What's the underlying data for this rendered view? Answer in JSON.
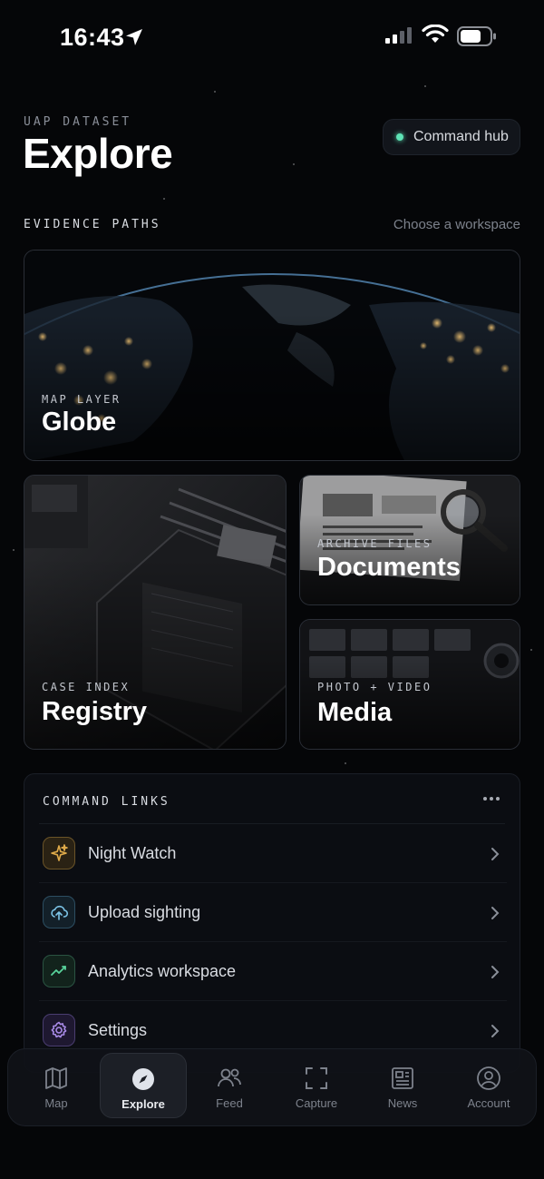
{
  "status_bar": {
    "time": "16:43"
  },
  "header": {
    "eyebrow": "UAP DATASET",
    "title": "Explore",
    "hub_button": "Command hub",
    "hub_status_color": "#5ee3b5"
  },
  "evidence": {
    "label": "EVIDENCE PATHS",
    "hint": "Choose a workspace",
    "cards": [
      {
        "sub": "MAP LAYER",
        "title": "Globe"
      },
      {
        "sub": "CASE INDEX",
        "title": "Registry"
      },
      {
        "sub": "ARCHIVE FILES",
        "title": "Documents"
      },
      {
        "sub": "PHOTO + VIDEO",
        "title": "Media"
      }
    ]
  },
  "command_links": {
    "title": "COMMAND LINKS",
    "items": [
      {
        "label": "Night Watch",
        "icon": "sparkles-icon",
        "color": "#d9a441"
      },
      {
        "label": "Upload sighting",
        "icon": "cloud-upload-icon",
        "color": "#7cc3e6"
      },
      {
        "label": "Analytics workspace",
        "icon": "trend-line-icon",
        "color": "#58d39b"
      },
      {
        "label": "Settings",
        "icon": "gear-icon",
        "color": "#a98be8"
      }
    ]
  },
  "tab_bar": {
    "tabs": [
      {
        "label": "Map",
        "icon": "map-icon"
      },
      {
        "label": "Explore",
        "icon": "compass-icon",
        "active": true
      },
      {
        "label": "Feed",
        "icon": "people-icon"
      },
      {
        "label": "Capture",
        "icon": "scan-frame-icon"
      },
      {
        "label": "News",
        "icon": "newspaper-icon"
      },
      {
        "label": "Account",
        "icon": "user-circle-icon"
      }
    ]
  }
}
